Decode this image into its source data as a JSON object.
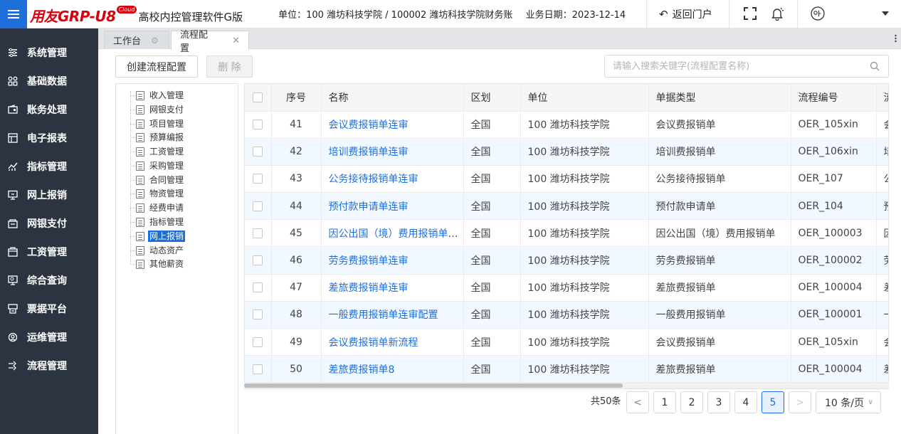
{
  "header": {
    "brand": "用友GRP-U8",
    "cloud_badge": "Cloud",
    "product": "高校内控管理软件G版",
    "unit_label": "单位：100 潍坊科技学院 / 100002 潍坊科技学院财务账",
    "date_label": "业务日期：2023-12-14",
    "back_label": "返回门户"
  },
  "sidebar": {
    "items": [
      {
        "label": "系统管理",
        "icon": "sliders-icon"
      },
      {
        "label": "基础数据",
        "icon": "grid-icon"
      },
      {
        "label": "账务处理",
        "icon": "wallet-icon"
      },
      {
        "label": "电子报表",
        "icon": "report-icon"
      },
      {
        "label": "指标管理",
        "icon": "chart-icon"
      },
      {
        "label": "网上报销",
        "icon": "monitor-icon"
      },
      {
        "label": "网银支付",
        "icon": "bank-icon"
      },
      {
        "label": "工资管理",
        "icon": "payroll-icon"
      },
      {
        "label": "综合查询",
        "icon": "query-icon"
      },
      {
        "label": "票据平台",
        "icon": "ticket-icon"
      },
      {
        "label": "运维管理",
        "icon": "ops-icon"
      },
      {
        "label": "流程管理",
        "icon": "flow-icon"
      }
    ]
  },
  "tabs": {
    "home": "工作台",
    "active": "流程配置"
  },
  "toolbar": {
    "create_label": "创建流程配置",
    "delete_label": "删 除",
    "search_placeholder": "请输入搜索关键字(流程配置名称)"
  },
  "tree": {
    "items": [
      "收入管理",
      "网银支付",
      "项目管理",
      "预算编报",
      "工资管理",
      "采购管理",
      "合同管理",
      "物资管理",
      "经费申请",
      "指标管理",
      "网上报销",
      "动态资产",
      "其他薪资"
    ],
    "selected": "网上报销"
  },
  "table": {
    "columns": [
      "序号",
      "名称",
      "区划",
      "单位",
      "单据类型",
      "流程编号",
      "流"
    ],
    "rows": [
      {
        "no": "41",
        "name": "会议费报销单连审",
        "region": "全国",
        "unit": "100 潍坊科技学院",
        "type": "会议费报销单",
        "code": "OER_105xin",
        "extra": "会"
      },
      {
        "no": "42",
        "name": "培训费报销单连审",
        "region": "全国",
        "unit": "100 潍坊科技学院",
        "type": "培训费报销单",
        "code": "OER_106xin",
        "extra": "培"
      },
      {
        "no": "43",
        "name": "公务接待报销单连审",
        "region": "全国",
        "unit": "100 潍坊科技学院",
        "type": "公务接待报销单",
        "code": "OER_107",
        "extra": "公"
      },
      {
        "no": "44",
        "name": "预付款申请单连审",
        "region": "全国",
        "unit": "100 潍坊科技学院",
        "type": "预付款申请单",
        "code": "OER_104",
        "extra": "预"
      },
      {
        "no": "45",
        "name": "因公出国（境）费用报销单连审",
        "region": "全国",
        "unit": "100 潍坊科技学院",
        "type": "因公出国（境）费用报销单",
        "code": "OER_100003",
        "extra": "因"
      },
      {
        "no": "46",
        "name": "劳务费报销单连审",
        "region": "全国",
        "unit": "100 潍坊科技学院",
        "type": "劳务费报销单",
        "code": "OER_100002",
        "extra": "劳"
      },
      {
        "no": "47",
        "name": "差旅费报销单连审",
        "region": "全国",
        "unit": "100 潍坊科技学院",
        "type": "差旅费报销单",
        "code": "OER_100004",
        "extra": "差"
      },
      {
        "no": "48",
        "name": "一般费用报销单连审配置",
        "region": "全国",
        "unit": "100 潍坊科技学院",
        "type": "一般费用报销单",
        "code": "OER_100001",
        "extra": "一"
      },
      {
        "no": "49",
        "name": "会议费报销单新流程",
        "region": "全国",
        "unit": "100 潍坊科技学院",
        "type": "会议费报销单",
        "code": "OER_105xin",
        "extra": "会"
      },
      {
        "no": "50",
        "name": "差旅费报销单8",
        "region": "全国",
        "unit": "100 潍坊科技学院",
        "type": "差旅费报销单",
        "code": "OER_100004",
        "extra": "差"
      }
    ]
  },
  "pagination": {
    "total_label": "共50条",
    "pages": [
      "1",
      "2",
      "3",
      "4",
      "5"
    ],
    "current": "5",
    "page_size_label": "10 条/页",
    "prev": "<",
    "next": ">"
  },
  "colors": {
    "accent": "#1e6fd9",
    "sidebar_bg": "#2c3441",
    "brand_red": "#d7000f"
  }
}
